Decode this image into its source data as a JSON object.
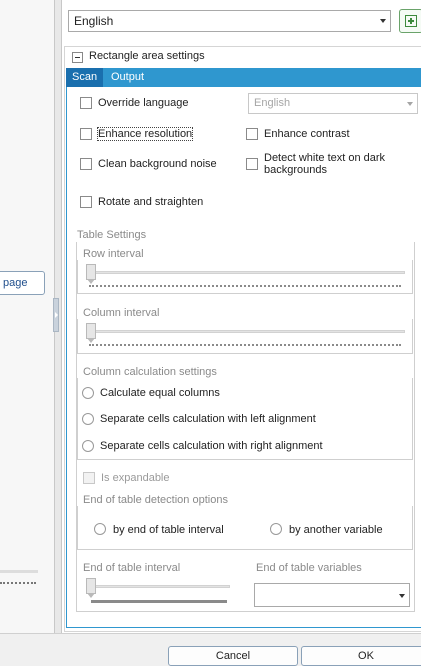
{
  "left_panel": {
    "page_button_label": "page"
  },
  "top": {
    "language_value": "English"
  },
  "section": {
    "title": "Rectangle area settings"
  },
  "tabs": [
    {
      "label": "Scan"
    },
    {
      "label": "Output"
    }
  ],
  "scan": {
    "override_language": {
      "label": "Override language",
      "checked": false
    },
    "override_language_select": "English",
    "enhance_resolution": {
      "label": "Enhance resolution",
      "checked": false
    },
    "enhance_contrast": {
      "label": "Enhance contrast",
      "checked": false
    },
    "clean_background_noise": {
      "label": "Clean background noise",
      "checked": false
    },
    "detect_white_text": {
      "label": "Detect white text on dark backgrounds",
      "checked": false
    },
    "rotate_straighten": {
      "label": "Rotate and straighten",
      "checked": false
    }
  },
  "table_settings": {
    "title": "Table Settings",
    "row_interval": {
      "label": "Row interval",
      "value": 0
    },
    "column_interval": {
      "label": "Column interval",
      "value": 0
    },
    "column_calc": {
      "title": "Column calculation settings",
      "options": [
        "Calculate equal columns",
        "Separate cells calculation with left alignment",
        "Separate cells calculation with right alignment"
      ]
    },
    "is_expandable": {
      "label": "Is expandable",
      "checked": false
    },
    "end_detection": {
      "title": "End of table detection options",
      "options": [
        "by end of table interval",
        "by another variable"
      ]
    },
    "end_interval": {
      "label": "End of table interval",
      "value": 0
    },
    "end_variables": {
      "label": "End of table variables",
      "value": ""
    }
  },
  "footer": {
    "cancel_label": "Cancel",
    "ok_label": "OK"
  }
}
